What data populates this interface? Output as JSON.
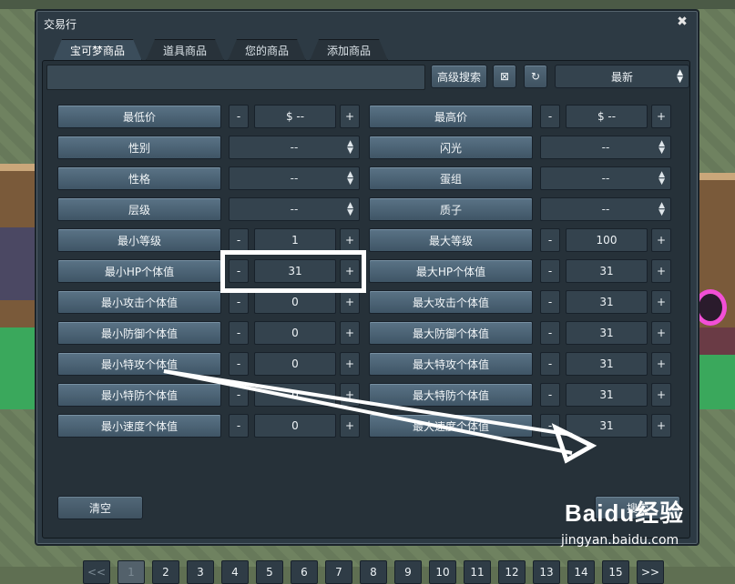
{
  "window": {
    "title": "交易行",
    "close_glyph": "✖"
  },
  "tabs": [
    {
      "label": "宝可梦商品",
      "active": true
    },
    {
      "label": "道具商品",
      "active": false
    },
    {
      "label": "您的商品",
      "active": false
    },
    {
      "label": "添加商品",
      "active": false
    }
  ],
  "toolbar": {
    "search_value": "",
    "advanced_search": "高级搜索",
    "clear_icon": "⊠",
    "refresh_icon": "↻",
    "sort_value": "最新",
    "sort_arrows": "▲▼"
  },
  "filters": {
    "left": [
      {
        "label": "最低价",
        "kind": "stepper",
        "value": "$ --"
      },
      {
        "label": "性别",
        "kind": "select",
        "value": "--"
      },
      {
        "label": "性格",
        "kind": "select",
        "value": "--"
      },
      {
        "label": "层级",
        "kind": "select",
        "value": "--"
      },
      {
        "label": "最小等级",
        "kind": "stepper",
        "value": "1"
      },
      {
        "label": "最小HP个体值",
        "kind": "stepper",
        "value": "31"
      },
      {
        "label": "最小攻击个体值",
        "kind": "stepper",
        "value": "0"
      },
      {
        "label": "最小防御个体值",
        "kind": "stepper",
        "value": "0"
      },
      {
        "label": "最小特攻个体值",
        "kind": "stepper",
        "value": "0"
      },
      {
        "label": "最小特防个体值",
        "kind": "stepper",
        "value": "0"
      },
      {
        "label": "最小速度个体值",
        "kind": "stepper",
        "value": "0"
      }
    ],
    "right": [
      {
        "label": "最高价",
        "kind": "stepper",
        "value": "$ --"
      },
      {
        "label": "闪光",
        "kind": "select",
        "value": "--"
      },
      {
        "label": "蛋组",
        "kind": "select",
        "value": "--"
      },
      {
        "label": "质子",
        "kind": "select",
        "value": "--"
      },
      {
        "label": "最大等级",
        "kind": "stepper",
        "value": "100"
      },
      {
        "label": "最大HP个体值",
        "kind": "stepper",
        "value": "31"
      },
      {
        "label": "最大攻击个体值",
        "kind": "stepper",
        "value": "31"
      },
      {
        "label": "最大防御个体值",
        "kind": "stepper",
        "value": "31"
      },
      {
        "label": "最大特攻个体值",
        "kind": "stepper",
        "value": "31"
      },
      {
        "label": "最大特防个体值",
        "kind": "stepper",
        "value": "31"
      },
      {
        "label": "最大速度个体值",
        "kind": "stepper",
        "value": "31"
      }
    ],
    "minus": "-",
    "plus": "+"
  },
  "actions": {
    "clear": "清空",
    "search": "搜索"
  },
  "pagination": {
    "prev": "<<",
    "pages": [
      "1",
      "2",
      "3",
      "4",
      "5",
      "6",
      "7",
      "8",
      "9",
      "10",
      "11",
      "12",
      "13",
      "14",
      "15"
    ],
    "next": ">>",
    "current": "1"
  },
  "watermark": {
    "brand": "Baidu经验",
    "url": "jingyan.baidu.com"
  }
}
